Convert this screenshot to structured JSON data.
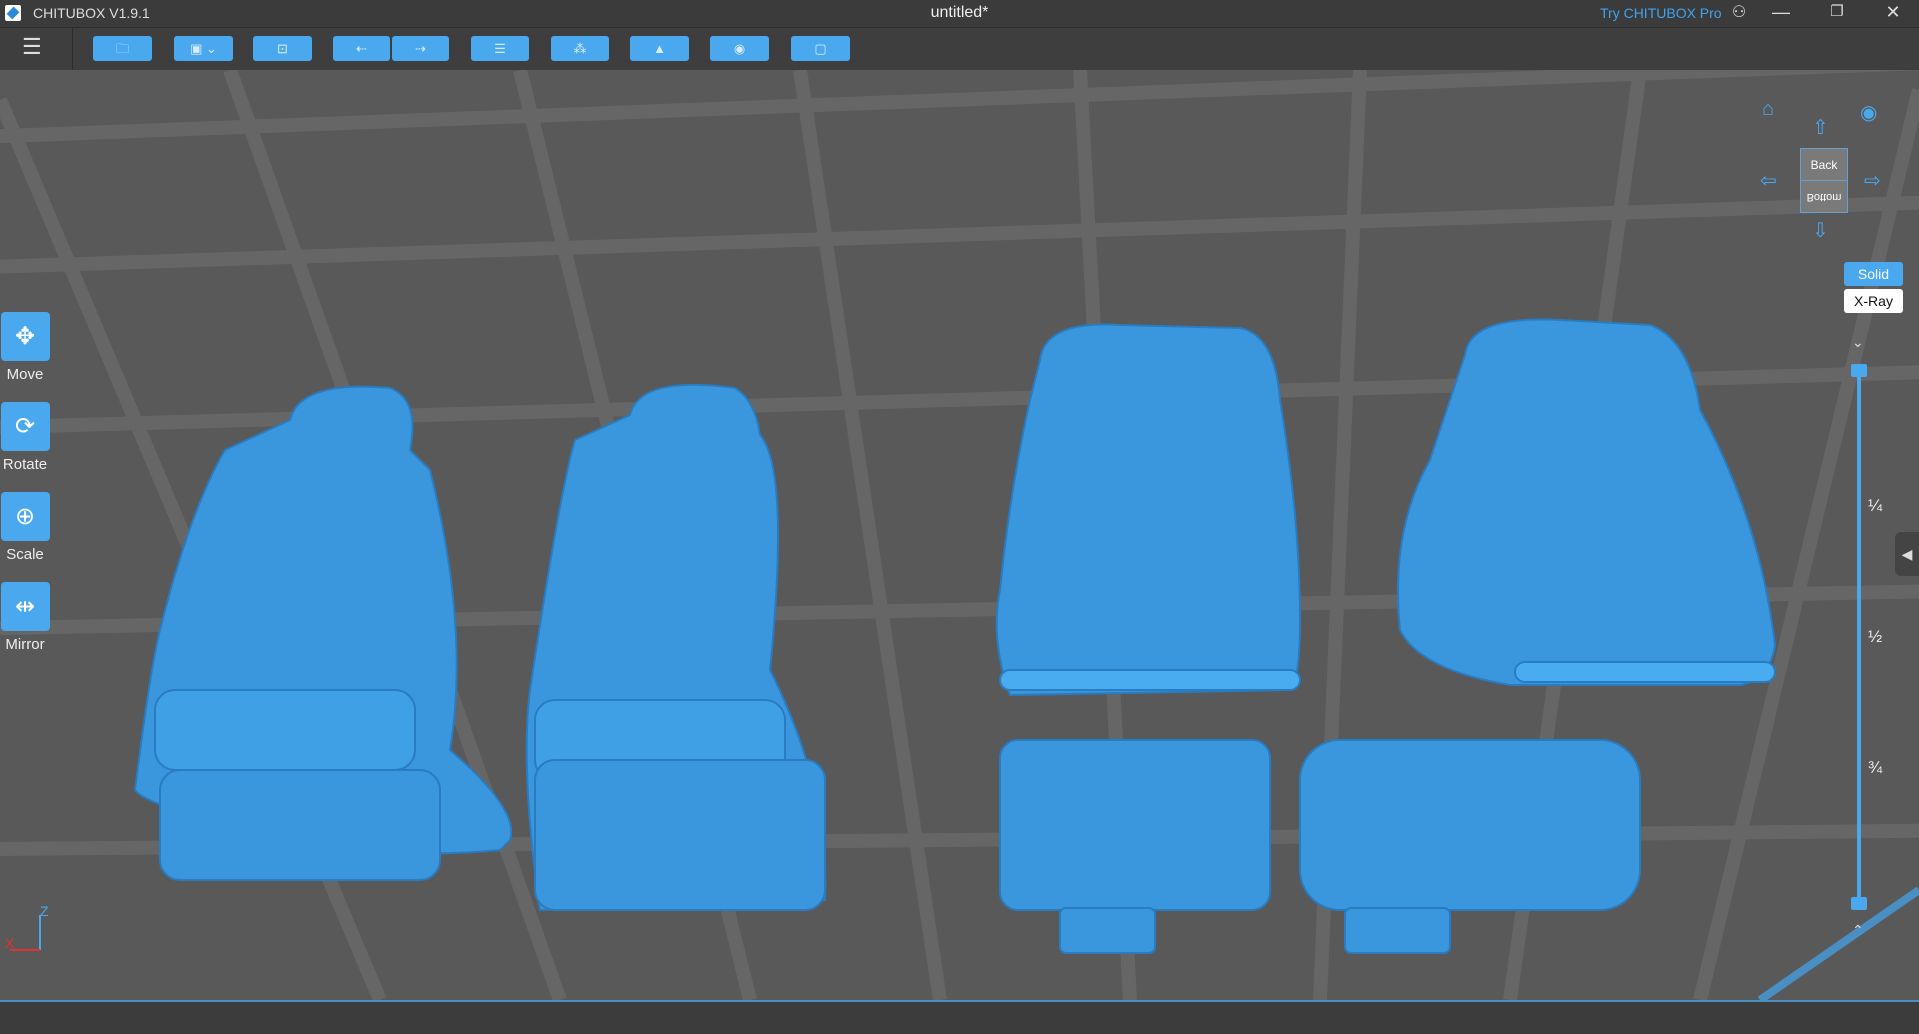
{
  "titlebar": {
    "app": "CHITUBOX V1.9.1",
    "document": "untitled*",
    "try_pro": "Try CHITUBOX Pro",
    "minimize": "—",
    "restore": "❐",
    "close": "✕"
  },
  "toolbar": {
    "buttons": [
      {
        "name": "open-file",
        "glyph": "🗀"
      },
      {
        "name": "save",
        "glyph": "▣ ⌄"
      },
      {
        "name": "auto-layout",
        "glyph": "⊡"
      },
      {
        "name": "undo",
        "glyph": "⇠"
      },
      {
        "name": "redo",
        "glyph": "⇢"
      },
      {
        "name": "model-list",
        "glyph": "☰"
      },
      {
        "name": "supports",
        "glyph": "⁂"
      },
      {
        "name": "hollow",
        "glyph": "▲"
      },
      {
        "name": "dig-hole",
        "glyph": "◉"
      },
      {
        "name": "slice",
        "glyph": "▢"
      }
    ]
  },
  "tools": [
    {
      "label": "Move",
      "icon": "move-icon",
      "glyph": "✥"
    },
    {
      "label": "Rotate",
      "icon": "rotate-icon",
      "glyph": "⟳"
    },
    {
      "label": "Scale",
      "icon": "scale-icon",
      "glyph": "⊕"
    },
    {
      "label": "Mirror",
      "icon": "mirror-icon",
      "glyph": "⇹"
    }
  ],
  "view": {
    "cube_front": "Back",
    "cube_bottom": "Bottom",
    "solid": "Solid",
    "xray": "X-Ray"
  },
  "slider": {
    "quarter": "¼",
    "half": "½",
    "three_quarter": "¾",
    "top_value": 1.0,
    "bottom_value": 0.0
  },
  "axes": {
    "x": "X",
    "z": "Z"
  },
  "colors": {
    "accent": "#4aa8ef",
    "model": "#3a97de",
    "background": "#595959"
  }
}
